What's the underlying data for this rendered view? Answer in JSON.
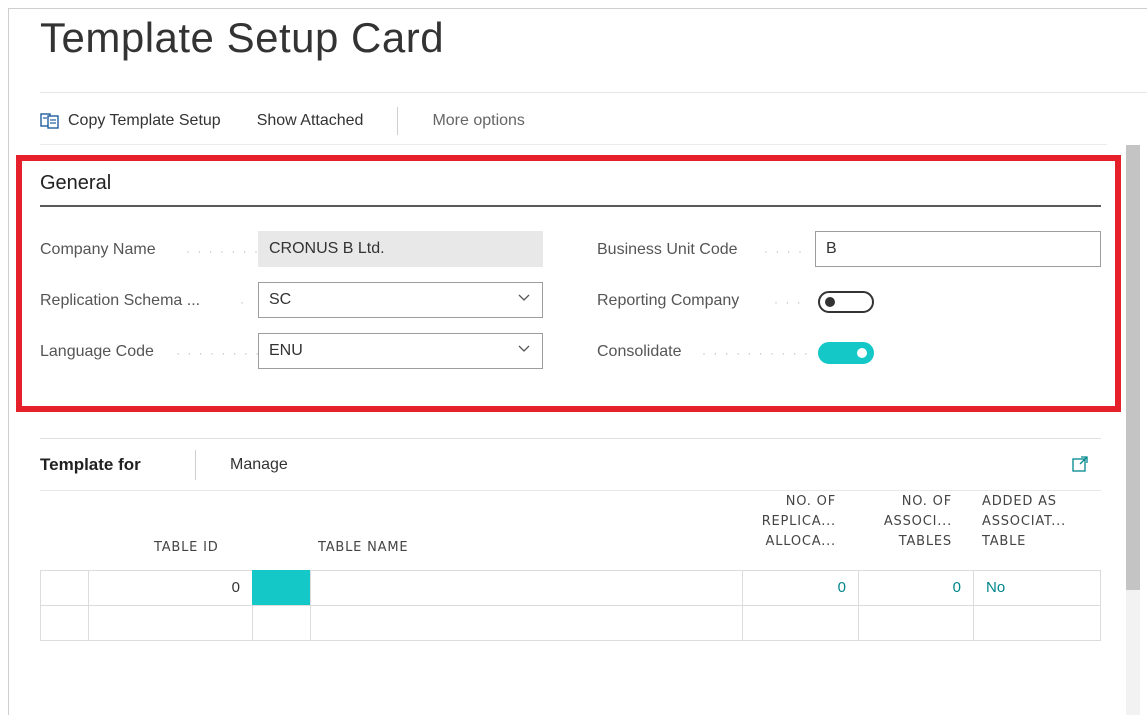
{
  "page": {
    "title": "Template Setup Card"
  },
  "actions": {
    "copy_template_setup": "Copy Template Setup",
    "show_attached": "Show Attached",
    "more_options": "More options"
  },
  "general": {
    "title": "General",
    "company_name_label": "Company Name",
    "company_name_value": "CRONUS B Ltd.",
    "replication_schema_label": "Replication Schema ...",
    "replication_schema_value": "SC",
    "language_code_label": "Language Code",
    "language_code_value": "ENU",
    "business_unit_code_label": "Business Unit Code",
    "business_unit_code_value": "B",
    "reporting_company_label": "Reporting Company",
    "reporting_company_value": false,
    "consolidate_label": "Consolidate",
    "consolidate_value": true
  },
  "template_for": {
    "title": "Template for",
    "manage": "Manage",
    "columns": {
      "table_id": "TABLE ID",
      "table_name": "TABLE NAME",
      "no_replica_1": "NO. OF",
      "no_replica_2": "REPLICA...",
      "no_replica_3": "ALLOCA...",
      "no_assoc_1": "NO. OF",
      "no_assoc_2": "ASSOCI...",
      "no_assoc_3": "TABLES",
      "added_1": "ADDED AS",
      "added_2": "ASSOCIAT...",
      "added_3": "TABLE"
    },
    "rows": [
      {
        "table_id": "0",
        "table_name": "",
        "no_replica": "0",
        "no_assoc": "0",
        "added": "No"
      }
    ]
  },
  "colors": {
    "accent": "#14c8c8",
    "highlight": "#e6202a",
    "link": "#00868b"
  }
}
